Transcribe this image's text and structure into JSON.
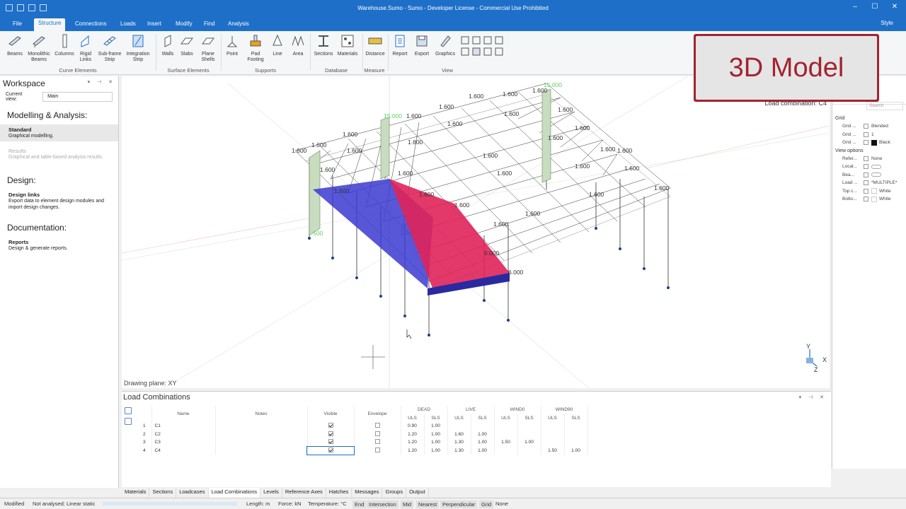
{
  "window": {
    "title": "Warehouse.Sumo - Sumo - Developer License - Commercial Use Prohibited"
  },
  "ribbon": {
    "tabs": [
      "File",
      "Structure",
      "Connections",
      "Loads",
      "Insert",
      "Modify",
      "Find",
      "Analysis"
    ],
    "style_label": "Style",
    "buttons": {
      "beams": "Beams",
      "monolithic": "Monolithic",
      "monolithic2": "Beams",
      "columns": "Columns",
      "rigid": "Rigid",
      "rigid2": "Links",
      "subframe": "Sub-frame",
      "subframe2": "Strip",
      "integration": "Integration",
      "integration2": "Strip",
      "walls": "Walls",
      "slabs": "Slabs",
      "plane": "Plane",
      "plane2": "Shells",
      "point": "Point",
      "pad": "Pad",
      "pad2": "Footing",
      "line": "Line",
      "area": "Area",
      "sections": "Sections",
      "materials": "Materials",
      "distance": "Distance",
      "report": "Report",
      "export": "Export",
      "graphics": "Graphics"
    },
    "groups": {
      "curve": "Curve Elements",
      "surface": "Surface Elements",
      "supports": "Supports",
      "database": "Database",
      "measure": "Measure",
      "view": "View"
    }
  },
  "badge": {
    "text": "3D Model"
  },
  "workspace": {
    "title": "Workspace",
    "current_view_label": "Current view:",
    "current_view_value": "Main",
    "sections": {
      "modelling": "Modelling & Analysis:",
      "design": "Design:",
      "documentation": "Documentation:"
    },
    "items": {
      "standard_h": "Standard",
      "standard_d": "Graphical modelling.",
      "results_h": "Results",
      "results_d": "Graphical and table-based analysis results.",
      "design_h": "Design links",
      "design_d1": "Export data to element design modules and",
      "design_d2": "import design changes.",
      "reports_h": "Reports",
      "reports_d": "Design & generate reports."
    }
  },
  "viewport": {
    "drawing_plane": "Drawing plane: XY",
    "load_combination": "Load combination: C4",
    "axis_x": "X",
    "axis_y": "Y",
    "axis_z": "Z",
    "labels": {
      "roof": "1.600",
      "header1": "15.000",
      "header2": "15.000",
      "ramp1": "6.000",
      "ramp2": "6.000",
      "low": "500"
    }
  },
  "properties": {
    "search_placeholder": "Search",
    "grid_cat": "Grid",
    "grid_rows": [
      {
        "k": "Grid ...",
        "v": "Blended"
      },
      {
        "k": "Grid ...",
        "v": "1"
      },
      {
        "k": "Grid ...",
        "v": "Black"
      }
    ],
    "view_cat": "View options",
    "view_rows": [
      {
        "k": "Refer...",
        "v": "None"
      },
      {
        "k": "Local...",
        "v": ""
      },
      {
        "k": "Bea...",
        "v": ""
      },
      {
        "k": "Load ...",
        "v": "*MULTIPLE*"
      },
      {
        "k": "Top c...",
        "v": "White"
      },
      {
        "k": "Botto...",
        "v": "White"
      }
    ]
  },
  "load_combinations": {
    "title": "Load Combinations",
    "headers": {
      "name": "Name",
      "notes": "Notes",
      "visible": "Visible",
      "envelope": "Envelope",
      "groups": [
        "DEAD",
        "LIVE",
        "WIND0",
        "WIND90"
      ],
      "uls": "ULS",
      "sls": "SLS"
    },
    "rows": [
      {
        "idx": "1",
        "name": "C1",
        "vals": [
          "0.90",
          "1.00",
          "",
          "",
          "",
          "",
          "",
          ""
        ]
      },
      {
        "idx": "2",
        "name": "C2",
        "vals": [
          "1.20",
          "1.00",
          "1.60",
          "1.00",
          "",
          "",
          "",
          ""
        ]
      },
      {
        "idx": "3",
        "name": "C3",
        "vals": [
          "1.20",
          "1.00",
          "1.30",
          "1.00",
          "1.50",
          "1.00",
          "",
          ""
        ]
      },
      {
        "idx": "4",
        "name": "C4",
        "vals": [
          "1.20",
          "1.00",
          "1.30",
          "1.00",
          "",
          "",
          "1.50",
          "1.00"
        ]
      }
    ]
  },
  "bottom_tabs": [
    "Materials",
    "Sections",
    "Loadcases",
    "Load Combinations",
    "Levels",
    "Reference Axes",
    "Hatches",
    "Messages",
    "Groups",
    "Output"
  ],
  "status": {
    "modified": "Modified",
    "analysed": "Not analysed: Linear static",
    "length": "Length: m",
    "force": "Force: kN",
    "temperature": "Temperature: °C",
    "snaps": [
      "End",
      "Intersection",
      "Mid",
      "Nearest",
      "Perpendicular",
      "Grid",
      "None"
    ]
  },
  "colors": {
    "accent": "#1e6fc8",
    "badge": "#a12430",
    "slab_red": "#e0245a",
    "slab_blue": "#3a3ad0"
  }
}
